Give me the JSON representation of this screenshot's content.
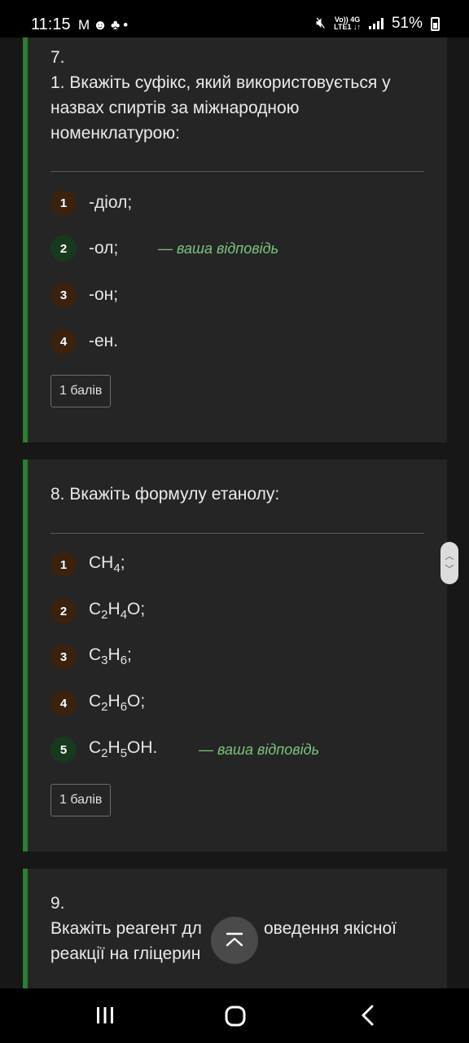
{
  "status_bar": {
    "time": "11:15",
    "left_icons": [
      "gmail-icon",
      "app-icon",
      "app-icon",
      "dot-icon"
    ],
    "network_top": "Vo)) 4G",
    "network_bottom": "LTE1 ↓↑",
    "battery": "51%"
  },
  "questions": [
    {
      "number": "7.",
      "text": "1. Вкажіть суфікс, який використовується у назвах спиртів за міжнародною номенклатурою:",
      "options": [
        {
          "num": "1",
          "text": "-діол;"
        },
        {
          "num": "2",
          "text": "-ол;",
          "answer": "— ваша відповідь"
        },
        {
          "num": "3",
          "text": "-он;"
        },
        {
          "num": "4",
          "text": "-ен."
        }
      ],
      "points": "1 балів"
    },
    {
      "number": "",
      "text": "8. Вкажіть формулу етанолу:",
      "options": [
        {
          "num": "1",
          "text": [
            "CH",
            "4",
            ";"
          ]
        },
        {
          "num": "2",
          "text": [
            "C",
            "2",
            "H",
            "4",
            "O;"
          ]
        },
        {
          "num": "3",
          "text": [
            "C",
            "3",
            "H",
            "6",
            ";"
          ]
        },
        {
          "num": "4",
          "text": [
            "C",
            "2",
            "H",
            "6",
            "O;"
          ]
        },
        {
          "num": "5",
          "text": [
            "C",
            "2",
            "H",
            "5",
            "OH."
          ],
          "answer": "— ваша відповідь"
        }
      ],
      "points": "1 балів"
    },
    {
      "number": "9.",
      "text_line1": "Вкажіть реагент дл",
      "text_line1b": "оведення якісної",
      "text_line2": "реакції на гліцерин"
    }
  ],
  "colors": {
    "accent": "#2d7d32",
    "answer": "#7bc47f",
    "card": "#252525"
  }
}
